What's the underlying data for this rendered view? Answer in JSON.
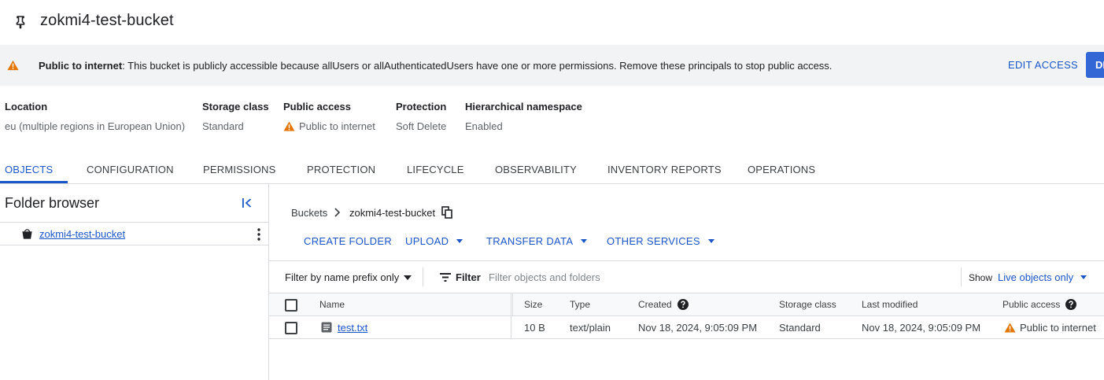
{
  "header": {
    "title": "zokmi4-test-bucket",
    "icon": "pin-icon"
  },
  "banner": {
    "bold": "Public to internet",
    "message": ": This bucket is publicly accessible because allUsers or allAuthenticatedUsers have one or more permissions. Remove these principals to stop public access.",
    "edit_access": "EDIT ACCESS",
    "cut_button": "DI",
    "warning_color": "#e37400"
  },
  "info": {
    "location": {
      "label": "Location",
      "value": "eu (multiple regions in European Union)"
    },
    "storage_class": {
      "label": "Storage class",
      "value": "Standard"
    },
    "public_access": {
      "label": "Public access",
      "value": "Public to internet"
    },
    "protection": {
      "label": "Protection",
      "value": "Soft Delete"
    },
    "hns": {
      "label": "Hierarchical namespace",
      "value": "Enabled"
    }
  },
  "tabs": [
    {
      "label": "OBJECTS",
      "active": true
    },
    {
      "label": "CONFIGURATION"
    },
    {
      "label": "PERMISSIONS"
    },
    {
      "label": "PROTECTION"
    },
    {
      "label": "LIFECYCLE"
    },
    {
      "label": "OBSERVABILITY"
    },
    {
      "label": "INVENTORY REPORTS"
    },
    {
      "label": "OPERATIONS"
    }
  ],
  "folder_browser": {
    "title": "Folder browser",
    "bucket": "zokmi4-test-bucket"
  },
  "breadcrumb": {
    "root": "Buckets",
    "current": "zokmi4-test-bucket"
  },
  "actions": {
    "create_folder": "CREATE FOLDER",
    "upload": "UPLOAD",
    "transfer_data": "TRANSFER DATA",
    "other_services": "OTHER SERVICES"
  },
  "filter": {
    "prefix_select": "Filter by name prefix only",
    "label": "Filter",
    "placeholder": "Filter objects and folders",
    "show_label": "Show",
    "show_value": "Live objects only"
  },
  "table": {
    "columns": {
      "name": "Name",
      "size": "Size",
      "type": "Type",
      "created": "Created",
      "storage_class": "Storage class",
      "last_modified": "Last modified",
      "public_access": "Public access"
    },
    "rows": [
      {
        "name": "test.txt",
        "size": "10 B",
        "type": "text/plain",
        "created": "Nov 18, 2024, 9:05:09 PM",
        "storage_class": "Standard",
        "last_modified": "Nov 18, 2024, 9:05:09 PM",
        "public_access": "Public to internet"
      }
    ]
  },
  "colors": {
    "accent": "#1a56c8",
    "warning": "#e37400"
  }
}
